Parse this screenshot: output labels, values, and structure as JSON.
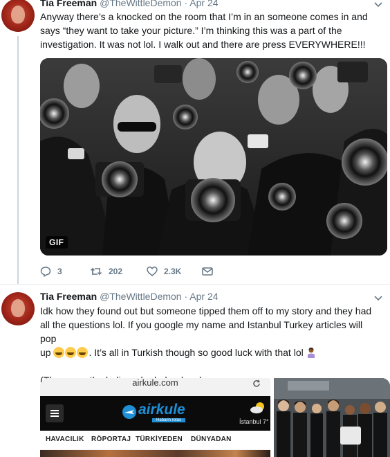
{
  "tweet1": {
    "name": "Tia Freeman",
    "handle": "@TheWittleDemon",
    "separator": "·",
    "date": "Apr 24",
    "lines": [
      "Anyway there’s a knocked on the room that I’m in an someone comes in and",
      "says “they want to take your picture.” I’m thinking this was a part of the",
      "investigation. It was not lol. I walk out and there are press EVERYWHERE!!!"
    ],
    "media_badge": "GIF",
    "replies": "3",
    "retweets": "202",
    "likes": "2.3K"
  },
  "tweet2": {
    "name": "Tia Freeman",
    "handle": "@TheWittleDemon",
    "separator": "·",
    "date": "Apr 24",
    "line1": "Idk how they found out but someone tipped them off to my story and they had",
    "line2": "all the questions lol. If you google my name and Istanbul Turkey articles will pop",
    "line3_start": "up",
    "line3_end": ". It’s all in Turkish though so good luck with that lol",
    "line5": "(These are the ladies who helped me)",
    "screenshot": {
      "url": "airkule.com",
      "logo": "airkule",
      "tagline": "Habarin rotas",
      "weather": "İstanbul 7°",
      "nav": [
        "HAVACILIK",
        "RÖPORTAJ",
        "TÜRKİYEDEN",
        "DÜNYADAN"
      ]
    }
  },
  "icons": {
    "reply": "reply-icon",
    "retweet": "retweet-icon",
    "like": "heart-icon",
    "dm": "envelope-icon",
    "caret": "chevron-down-icon",
    "emoji_laugh": "tears-of-joy-emoji",
    "emoji_person": "person-shrugging-emoji"
  },
  "colors": {
    "text": "#14171a",
    "secondary": "#657786",
    "thread_line": "#ccd6dd",
    "divider": "#e6ecf0",
    "airkule_blue": "#1f8fd6"
  }
}
